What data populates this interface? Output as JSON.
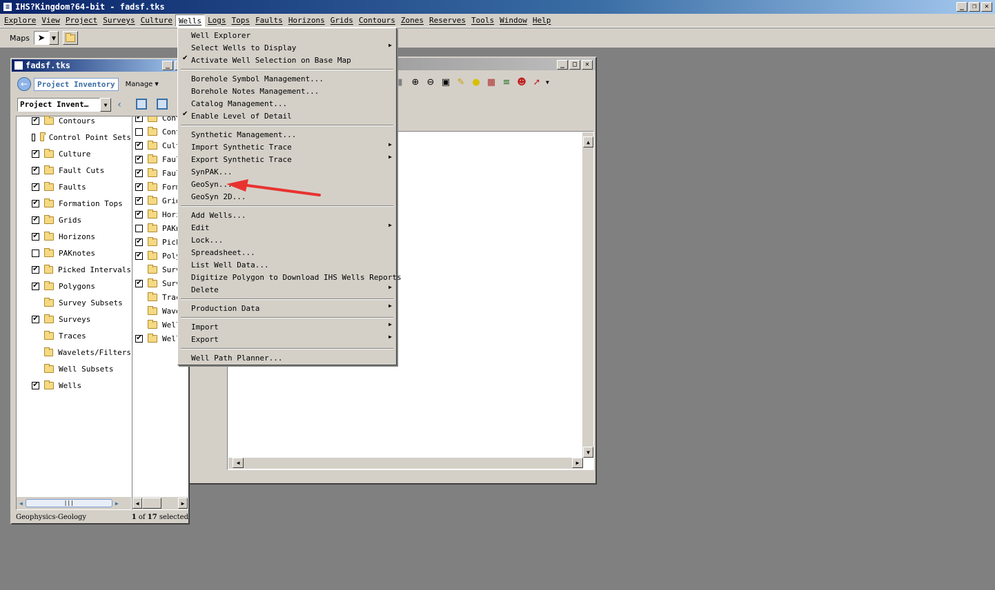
{
  "app": {
    "title": "IHS?Kingdom?64-bit - fadsf.tks"
  },
  "menubar": [
    "Explore",
    "View",
    "Project",
    "Surveys",
    "Culture",
    "Wells",
    "Logs",
    "Tops",
    "Faults",
    "Horizons",
    "Grids",
    "Contours",
    "Zones",
    "Reserves",
    "Tools",
    "Window",
    "Help"
  ],
  "toolbar": {
    "label": "Maps"
  },
  "project_window": {
    "title": "fadsf.tks",
    "inventory_tab": "Project Inventory",
    "manage": "Manage",
    "combo": "Project Invent…",
    "tree": [
      {
        "label": "Contours",
        "checked": true
      },
      {
        "label": "Control Point Sets",
        "checked": false
      },
      {
        "label": "Culture",
        "checked": true
      },
      {
        "label": "Fault Cuts",
        "checked": true
      },
      {
        "label": "Faults",
        "checked": true
      },
      {
        "label": "Formation Tops",
        "checked": true
      },
      {
        "label": "Grids",
        "checked": true
      },
      {
        "label": "Horizons",
        "checked": true
      },
      {
        "label": "PAKnotes",
        "checked": false
      },
      {
        "label": "Picked Intervals",
        "checked": true
      },
      {
        "label": "Polygons",
        "checked": true
      },
      {
        "label": "Survey Subsets",
        "checked": null
      },
      {
        "label": "Surveys",
        "checked": true
      },
      {
        "label": "Traces",
        "checked": null
      },
      {
        "label": "Wavelets/Filters",
        "checked": null
      },
      {
        "label": "Well Subsets",
        "checked": null
      },
      {
        "label": "Wells",
        "checked": true
      }
    ],
    "tree2": [
      {
        "label": "Cont",
        "checked": true
      },
      {
        "label": "Cont",
        "checked": false
      },
      {
        "label": "Cult",
        "checked": true
      },
      {
        "label": "Faul",
        "checked": true
      },
      {
        "label": "Faul",
        "checked": true
      },
      {
        "label": "Form",
        "checked": true
      },
      {
        "label": "Grid",
        "checked": true
      },
      {
        "label": "Hori",
        "checked": true
      },
      {
        "label": "PAKn",
        "checked": false
      },
      {
        "label": "Pick",
        "checked": true
      },
      {
        "label": "Poly",
        "checked": true
      },
      {
        "label": "Surv",
        "checked": null
      },
      {
        "label": "Surv",
        "checked": true
      },
      {
        "label": "Trac",
        "checked": null
      },
      {
        "label": "Wave",
        "checked": null
      },
      {
        "label": "Well",
        "checked": null
      },
      {
        "label": "Well",
        "checked": true
      }
    ],
    "status_left": "Geophysics-Geology",
    "status_count": "1",
    "status_of": "of",
    "status_total": "17",
    "status_selected": "selected"
  },
  "wells_menu": [
    {
      "type": "item",
      "label": "Well Explorer"
    },
    {
      "type": "item",
      "label": "Select Wells to Display",
      "submenu": true
    },
    {
      "type": "item",
      "label": "Activate Well Selection on Base Map",
      "checked": true
    },
    {
      "type": "sep"
    },
    {
      "type": "item",
      "label": "Borehole Symbol Management..."
    },
    {
      "type": "item",
      "label": "Borehole Notes Management..."
    },
    {
      "type": "item",
      "label": "Catalog Management..."
    },
    {
      "type": "item",
      "label": "Enable Level of Detail",
      "checked": true
    },
    {
      "type": "sep"
    },
    {
      "type": "item",
      "label": "Synthetic Management..."
    },
    {
      "type": "item",
      "label": "Import Synthetic Trace",
      "submenu": true
    },
    {
      "type": "item",
      "label": "Export Synthetic Trace",
      "submenu": true
    },
    {
      "type": "item",
      "label": "SynPAK..."
    },
    {
      "type": "item",
      "label": "GeoSyn..."
    },
    {
      "type": "item",
      "label": "GeoSyn 2D..."
    },
    {
      "type": "sep"
    },
    {
      "type": "item",
      "label": "Add Wells..."
    },
    {
      "type": "item",
      "label": "Edit",
      "submenu": true
    },
    {
      "type": "item",
      "label": "Lock..."
    },
    {
      "type": "item",
      "label": "Spreadsheet..."
    },
    {
      "type": "item",
      "label": "List Well Data..."
    },
    {
      "type": "item",
      "label": "Digitize Polygon to Download IHS Wells Reports"
    },
    {
      "type": "item",
      "label": "Delete",
      "submenu": true
    },
    {
      "type": "sep"
    },
    {
      "type": "item",
      "label": "Production Data",
      "submenu": true
    },
    {
      "type": "sep"
    },
    {
      "type": "item",
      "label": "Import",
      "submenu": true
    },
    {
      "type": "item",
      "label": "Export",
      "submenu": true
    },
    {
      "type": "sep"
    },
    {
      "type": "item",
      "label": "Well Path Planner..."
    }
  ],
  "colors": {
    "accent": "#0a246a",
    "arrow": "#e8332f"
  }
}
